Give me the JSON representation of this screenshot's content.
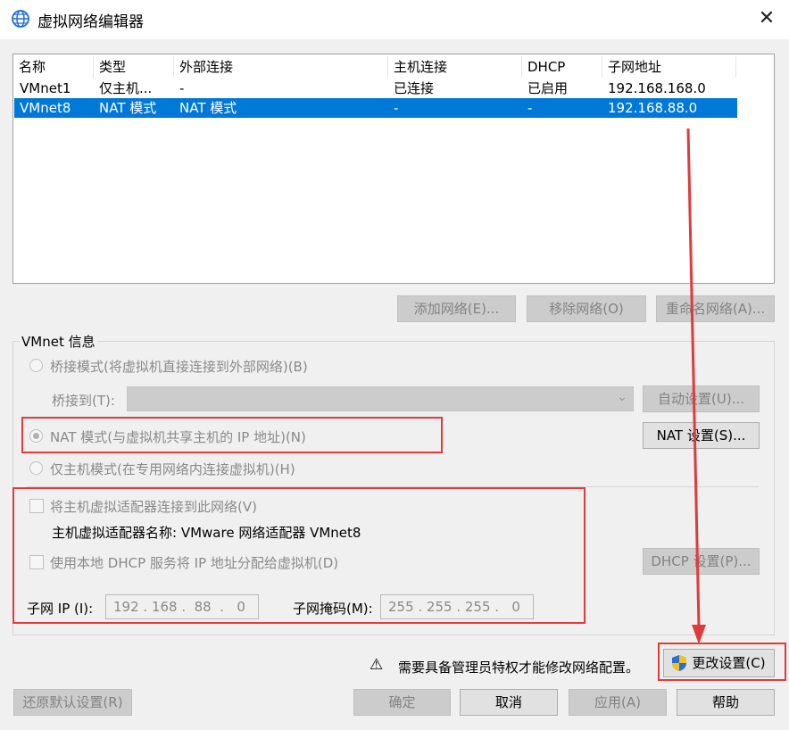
{
  "window": {
    "title": "虚拟网络编辑器",
    "close": "✕"
  },
  "table": {
    "columns": [
      "名称",
      "类型",
      "外部连接",
      "主机连接",
      "DHCP",
      "子网地址"
    ],
    "rows": [
      [
        "VMnet1",
        "仅主机...",
        "-",
        "已连接",
        "已启用",
        "192.168.168.0"
      ],
      [
        "VMnet8",
        "NAT 模式",
        "NAT 模式",
        "-",
        "-",
        "192.168.88.0"
      ]
    ],
    "selected_row": 1
  },
  "list_buttons": {
    "add": "添加网络(E)...",
    "remove": "移除网络(O)",
    "rename": "重命名网络(A)..."
  },
  "vmnet_info": {
    "label": "VMnet 信息",
    "bridge_mode": "桥接模式(将虚拟机直接连接到外部网络)(B)",
    "bridge_to_label": "桥接到(T):",
    "bridge_to_value": "",
    "auto_settings": "自动设置(U)...",
    "nat_mode": "NAT 模式(与虚拟机共享主机的 IP 地址)(N)",
    "nat_settings": "NAT 设置(S)...",
    "host_only": "仅主机模式(在专用网络内连接虚拟机)(H)",
    "connect_adapter": "将主机虚拟适配器连接到此网络(V)",
    "adapter_name": "主机虚拟适配器名称: VMware 网络适配器 VMnet8",
    "use_dhcp": "使用本地 DHCP 服务将 IP 地址分配给虚拟机(D)",
    "dhcp_settings": "DHCP 设置(P)...",
    "subnet_ip_label": "子网 IP (I):",
    "subnet_ip": "192 . 168 .  88  .   0",
    "subnet_mask_label": "子网掩码(M):",
    "subnet_mask": "255 . 255 . 255 .   0",
    "selected_mode": "nat"
  },
  "admin_notice": {
    "icon": "⚠",
    "text": "需要具备管理员特权才能修改网络配置。",
    "change_settings": "更改设置(C)"
  },
  "footer": {
    "restore": "还原默认设置(R)",
    "ok": "确定",
    "cancel": "取消",
    "apply": "应用(A)",
    "help": "帮助"
  },
  "colors": {
    "selection": "#0078d7",
    "annotation": "#e03a3a",
    "title_icon": "#1e6fd9"
  }
}
